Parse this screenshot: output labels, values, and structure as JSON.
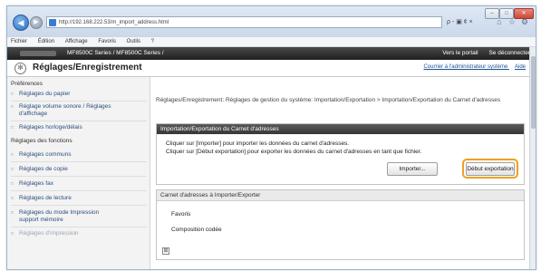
{
  "browser": {
    "url": "http://192.168.222.53/m_import_address.html",
    "search_label": "ρ - ▣ ¢ ×",
    "menu": [
      "Fichier",
      "Édition",
      "Affichage",
      "Favoris",
      "Outils",
      "?"
    ]
  },
  "device_header": {
    "model": "MF8500C Series / MF8500C Series /",
    "links": [
      "Vers le portail",
      "Se déconnecter"
    ]
  },
  "page": {
    "title": "Réglages/Enregistrement",
    "top_links": [
      "Courrier à l'administrateur système",
      "Aide"
    ]
  },
  "sidebar": {
    "header_preferences": "Préférences",
    "preferences_items": [
      {
        "label": "Réglages du papier"
      },
      {
        "label": "Réglage volume sonore / Réglages d'affichage"
      },
      {
        "label": "Réglages horloge/délais"
      }
    ],
    "header_functions": "Réglages des fonctions",
    "functions_items": [
      {
        "label": "Réglages communs"
      },
      {
        "label": "Réglages de copie"
      },
      {
        "label": "Réglages fax"
      },
      {
        "label": "Réglages de lecture"
      },
      {
        "label": "Réglages du mode Impression support mémoire"
      },
      {
        "label": "Réglages d'impression"
      }
    ]
  },
  "main": {
    "breadcrumb": "Réglages/Enregistrement: Réglages de gestion du système: Importation/Exportation > Importation/Exportation du Carnet d'adresses",
    "import_export_panel": {
      "title": "Importation/Exportation du Carnet d'adresses",
      "line1": "Cliquer sur [Importer] pour importer les données du carnet d'adresses.",
      "line2": "Cliquer sur [Début exportation] pour exporter les données du carnet d'adresses en tant que fichier.",
      "import_button": "Importer...",
      "export_button": "Début exportation"
    },
    "address_book_panel": {
      "title": "Carnet d'adresses à Importer/Exporter",
      "items": [
        "Favoris",
        "Composition codée"
      ],
      "expander_label": "⊞"
    }
  }
}
